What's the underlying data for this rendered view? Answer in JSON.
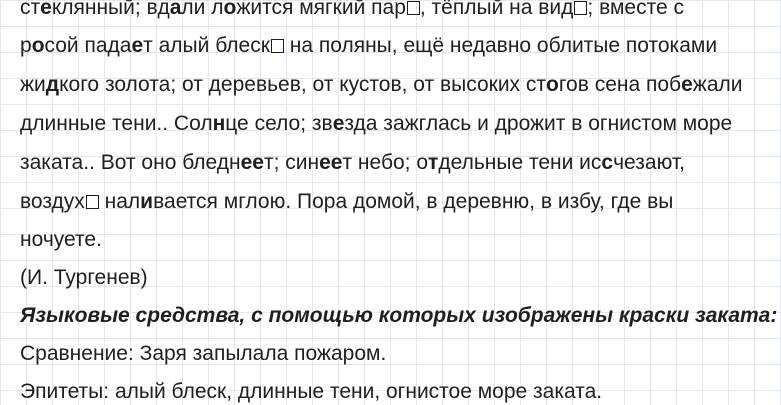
{
  "text": {
    "l1": {
      "a": "ст",
      "b": "е",
      "c": "клянный; вд",
      "d": "а",
      "e": "ли л",
      "f": "о",
      "g": "жится мягкий пар",
      "h": ", тёплый на вид",
      "i": "; вместе с"
    },
    "l2": {
      "a": "р",
      "b": "о",
      "c": "сой пада",
      "d": "е",
      "e": "т алый блеск",
      "f": " на поляны, ещё недавно облитые потоками"
    },
    "l3": {
      "a": "жи",
      "b": "д",
      "c": "кого золота; от деревьев, от кустов, от высоких ст",
      "d": "о",
      "e": "гов сена поб",
      "f": "е",
      "g": "жали"
    },
    "l4": {
      "a": "длинные тени.. Сол",
      "b": "н",
      "c": "це село; зв",
      "d": "е",
      "e": "зда зажглась и дрожит в огнистом море"
    },
    "l5": {
      "a": "заката.. Вот оно бледн",
      "b": "ее",
      "c": "т; син",
      "d": "ее",
      "e": "т небо; о",
      "f": "т",
      "g": "дельные тени ис",
      "h": "с",
      "i": "чезают,"
    },
    "l6": {
      "a": "воздух",
      "b": " нал",
      "c": "и",
      "d": "вается мглою. Пора домой, в деревню, в избу, где вы"
    },
    "l7": "ночуете.",
    "l8": "(И. Тургенев)",
    "heading": "Языковые средства, с помощью которых изображены краски заката:",
    "l10": "Сравнение: Заря запылала пожаром.",
    "l11": "Эпитеты: алый блеск, длинные тени, огнистое море заката."
  }
}
